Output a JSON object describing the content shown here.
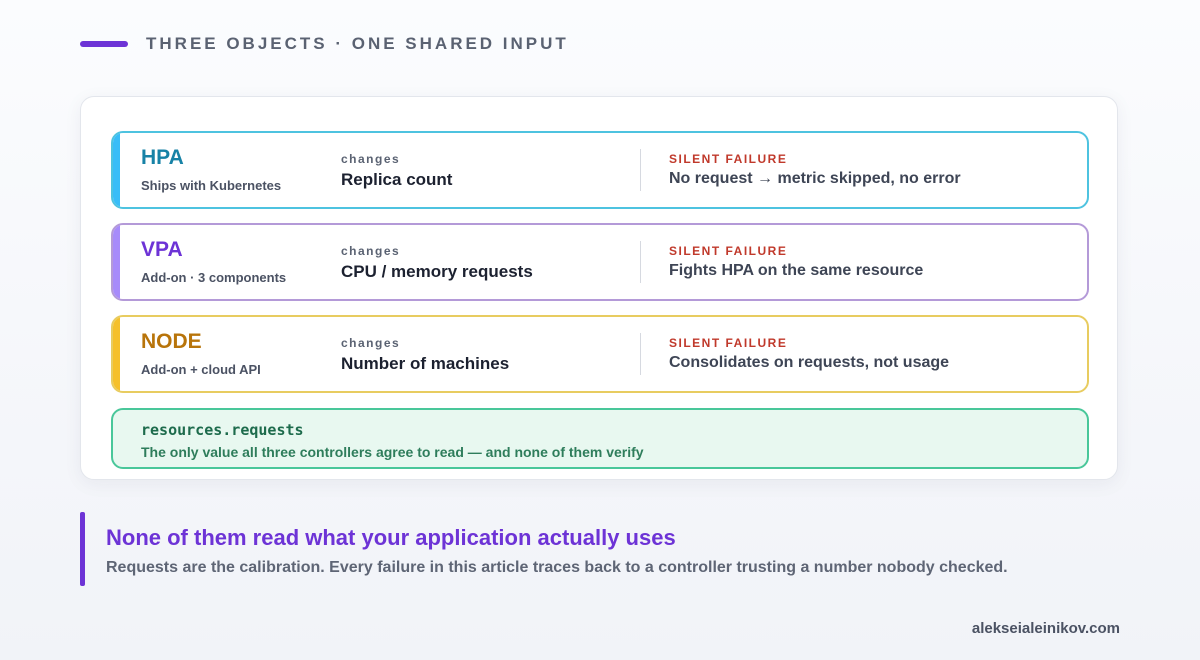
{
  "header": {
    "title": "THREE OBJECTS · ONE SHARED INPUT"
  },
  "rows": [
    {
      "name": "HPA",
      "subtitle": "Ships with Kubernetes",
      "changes_label": "changes",
      "changes_value": "Replica count",
      "failure_label": "SILENT FAILURE",
      "failure_value": "No request → metric skipped, no error",
      "colors": {
        "border": "#4ec3e0",
        "accent": "#38bdf8",
        "name": "#1782a6"
      }
    },
    {
      "name": "VPA",
      "subtitle": "Add-on · 3 components",
      "changes_label": "changes",
      "changes_value": "CPU / memory requests",
      "failure_label": "SILENT FAILURE",
      "failure_value": "Fights HPA on the same resource",
      "colors": {
        "border": "#b49ad8",
        "accent": "#a78bfa",
        "name": "#6d33d6"
      }
    },
    {
      "name": "NODE",
      "subtitle": "Add-on + cloud API",
      "changes_label": "changes",
      "changes_value": "Number of machines",
      "failure_label": "SILENT FAILURE",
      "failure_value": "Consolidates on requests, not usage",
      "colors": {
        "border": "#e8cc60",
        "accent": "#f5c02b",
        "name": "#b8740a"
      }
    }
  ],
  "shared_input": {
    "code": "resources.requests",
    "description": "The only value all three controllers agree to read — and none of them verify"
  },
  "callout": {
    "heading": "None of them read what your application actually uses",
    "body": "Requests are the calibration. Every failure in this article traces back to a controller trusting a number nobody checked."
  },
  "footer": {
    "site": "alekseialeinikov.com"
  }
}
